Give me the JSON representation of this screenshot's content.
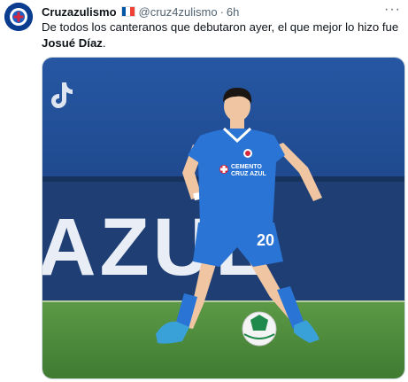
{
  "tweet": {
    "display_name": "Cruzazulismo",
    "flag": "france-flag",
    "handle": "@cruz4zulismo",
    "separator": "·",
    "time": "6h",
    "text_plain": "De todos los canteranos que debutaron ayer, el que mejor lo hizo fue ",
    "text_bold": "Josué Díaz",
    "text_end": ".",
    "more_label": "···"
  },
  "media": {
    "watermark": "tiktok-logo",
    "banner_text": "AZUL",
    "jersey_number": "20",
    "sponsor_text_line1": "CEMENTO",
    "sponsor_text_line2": "CRUZ AZUL",
    "colors": {
      "kit_blue": "#2a74d6",
      "banner_blue": "#1f3f74",
      "grass": "#4e8a3a"
    }
  }
}
